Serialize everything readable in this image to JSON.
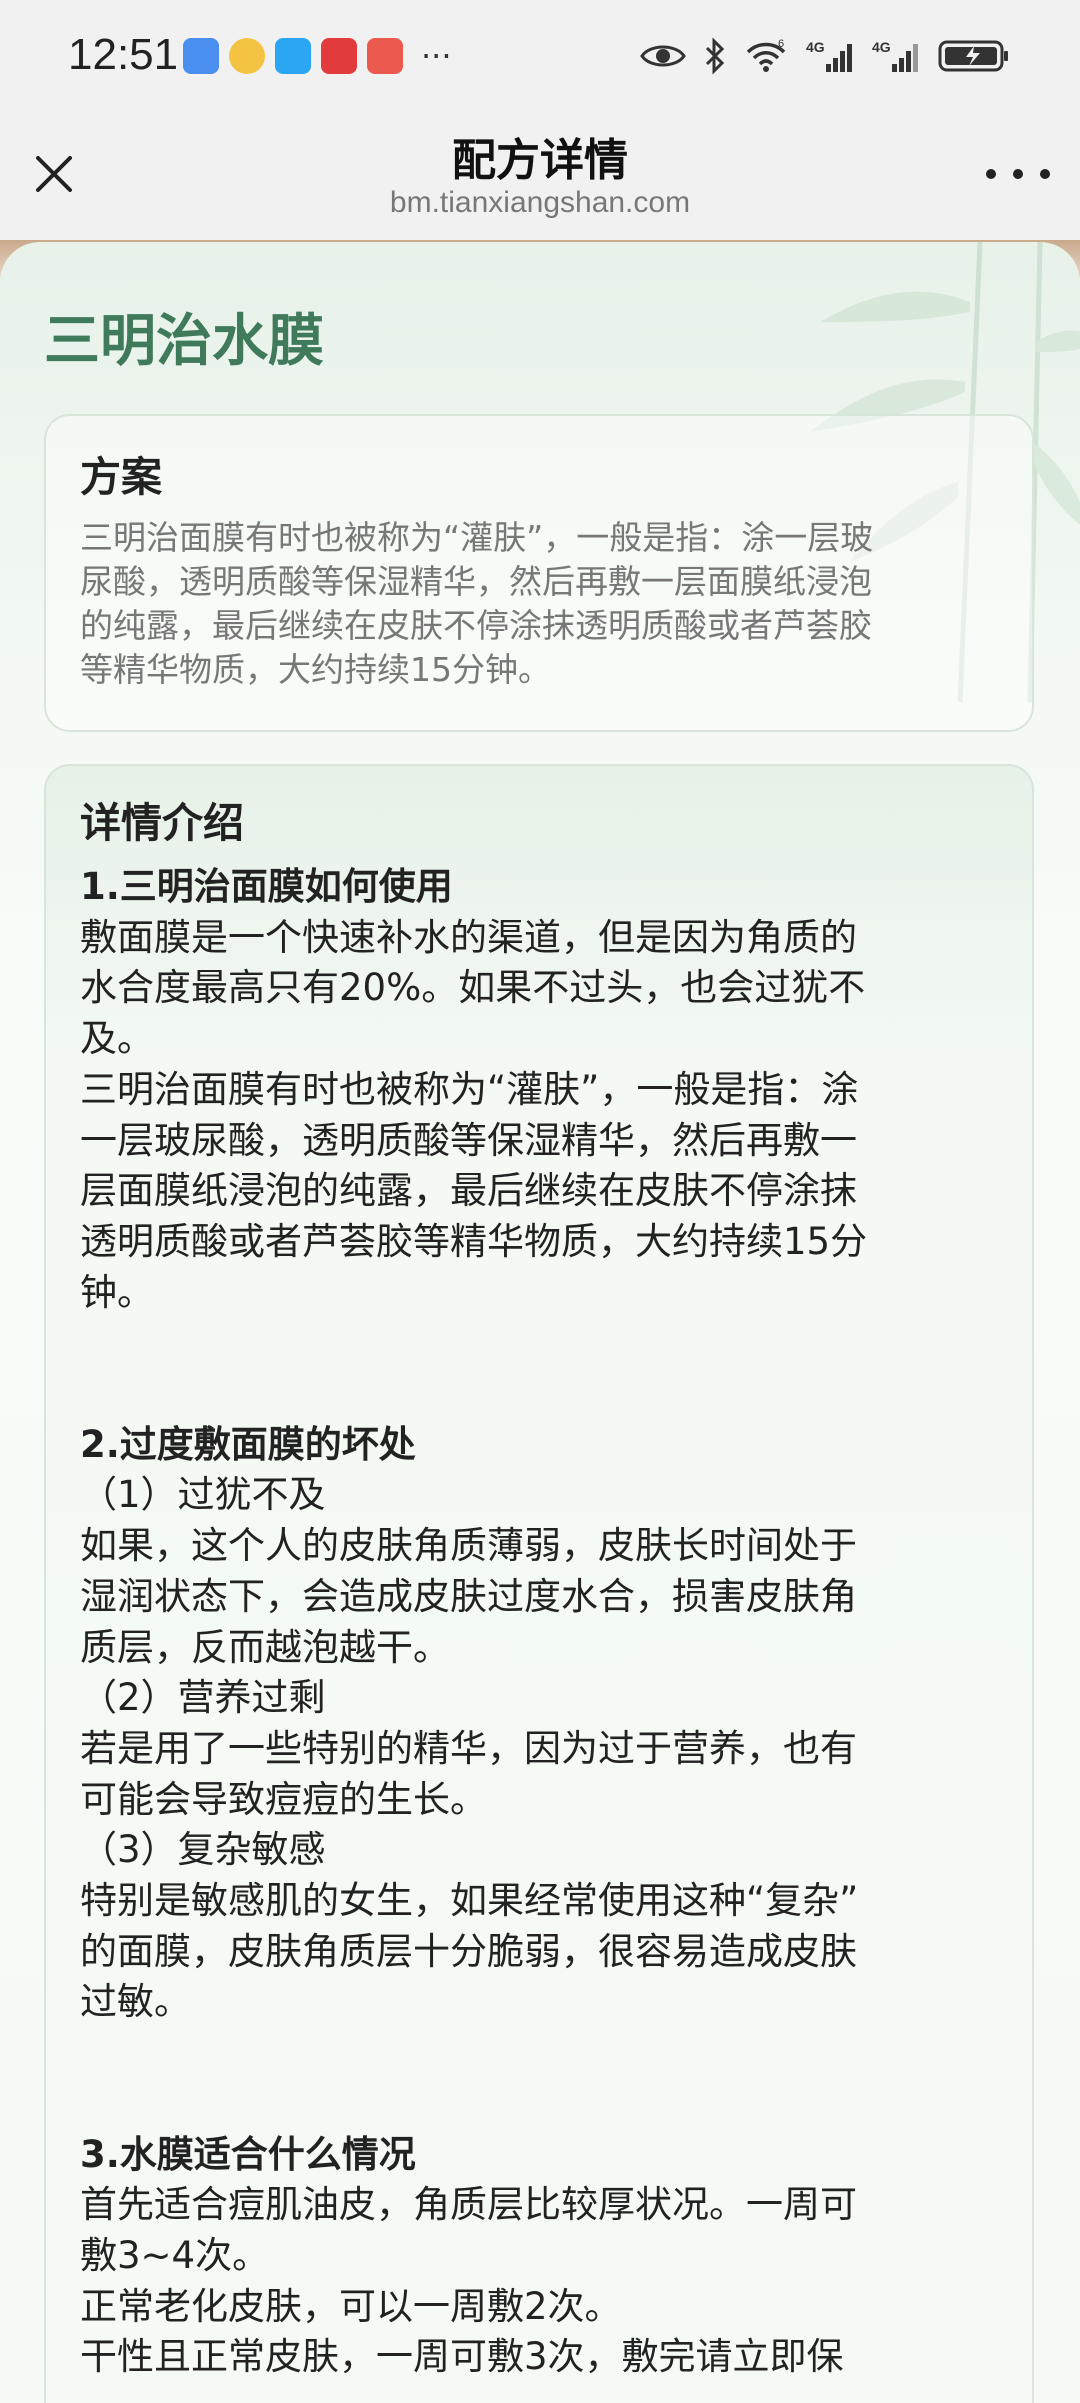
{
  "status_bar": {
    "time": "12:51",
    "more": "···",
    "network_1": "4G",
    "network_2": "4G",
    "wifi_badge": "6",
    "app_icons": [
      "qq-icon",
      "weibo-icon",
      "message-icon",
      "huawei-icon",
      "taobao-icon"
    ],
    "app_icon_colors": [
      "#3b82f6",
      "#ef4444",
      "#2196f3",
      "#e53935",
      "#e64a4a"
    ]
  },
  "navbar": {
    "title": "配方详情",
    "url": "bm.tianxiangshan.com"
  },
  "page": {
    "title": "三明治水膜",
    "title_color": "#3f7a5a",
    "plan": {
      "heading": "方案",
      "lines": [
        "三明治面膜有时也被称为“灌肤”，一般是指：涂一层玻",
        "尿酸，透明质酸等保湿精华，然后再敷一层面膜纸浸泡",
        "的纯露，最后继续在皮肤不停涂抹透明质酸或者芦荟胶",
        "等精华物质，大约持续15分钟。"
      ]
    },
    "details": {
      "heading": "详情介绍",
      "section1": {
        "title": "1.三明治面膜如何使用",
        "lines": [
          "敷面膜是一个快速补水的渠道，但是因为角质的",
          "水合度最高只有20%。如果不过头，也会过犹不",
          "及。",
          "三明治面膜有时也被称为“灌肤”，一般是指：涂",
          "一层玻尿酸，透明质酸等保湿精华，然后再敷一",
          "层面膜纸浸泡的纯露，最后继续在皮肤不停涂抹",
          "透明质酸或者芦荟胶等精华物质，大约持续15分",
          "钟。"
        ]
      },
      "section2": {
        "title": "2.过度敷面膜的坏处",
        "lines": [
          "（1）过犹不及",
          "如果，这个人的皮肤角质薄弱，皮肤长时间处于",
          "湿润状态下，会造成皮肤过度水合，损害皮肤角",
          "质层，反而越泡越干。",
          "（2）营养过剩",
          "若是用了一些特别的精华，因为过于营养，也有",
          "可能会导致痘痘的生长。",
          "（3）复杂敏感",
          "特别是敏感肌的女生，如果经常使用这种“复杂”",
          "的面膜，皮肤角质层十分脆弱，很容易造成皮肤",
          "过敏。"
        ]
      },
      "section3": {
        "title": "3.水膜适合什么情况",
        "lines": [
          "首先适合痘肌油皮，角质层比较厚状况。一周可",
          "敷3~4次。",
          "正常老化皮肤，可以一周敷2次。",
          "干性且正常皮肤，一周可敷3次，敷完请立即保"
        ]
      }
    }
  }
}
